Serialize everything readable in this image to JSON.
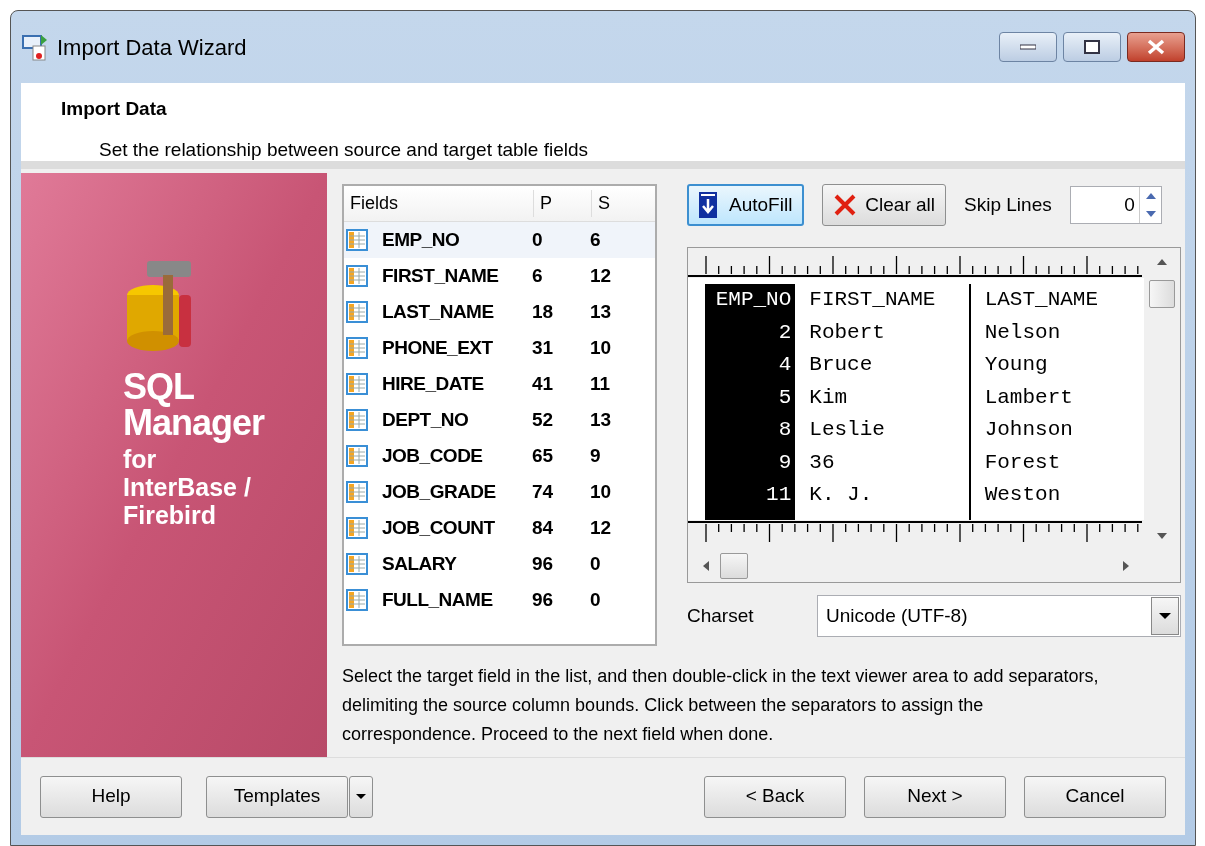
{
  "window": {
    "title": "Import Data Wizard"
  },
  "header": {
    "title": "Import Data",
    "subtitle": "Set the relationship between source and target table fields"
  },
  "banner": {
    "lines": [
      "SQL",
      "Manager"
    ],
    "sublines": [
      "for",
      "InterBase /",
      "Firebird"
    ]
  },
  "fields": {
    "columns": [
      "Fields",
      "P",
      "S"
    ],
    "rows": [
      {
        "name": "EMP_NO",
        "p": "0",
        "s": "6",
        "selected": true
      },
      {
        "name": "FIRST_NAME",
        "p": "6",
        "s": "12",
        "selected": false
      },
      {
        "name": "LAST_NAME",
        "p": "18",
        "s": "13",
        "selected": false
      },
      {
        "name": "PHONE_EXT",
        "p": "31",
        "s": "10",
        "selected": false
      },
      {
        "name": "HIRE_DATE",
        "p": "41",
        "s": "11",
        "selected": false
      },
      {
        "name": "DEPT_NO",
        "p": "52",
        "s": "13",
        "selected": false
      },
      {
        "name": "JOB_CODE",
        "p": "65",
        "s": "9",
        "selected": false
      },
      {
        "name": "JOB_GRADE",
        "p": "74",
        "s": "10",
        "selected": false
      },
      {
        "name": "JOB_COUNT",
        "p": "84",
        "s": "12",
        "selected": false
      },
      {
        "name": "SALARY",
        "p": "96",
        "s": "0",
        "selected": false
      },
      {
        "name": "FULL_NAME",
        "p": "96",
        "s": "0",
        "selected": false
      }
    ]
  },
  "toolbar": {
    "autofill": "AutoFill",
    "clear": "Clear all",
    "skip_label": "Skip Lines",
    "skip_value": "0"
  },
  "viewer": {
    "columns": [
      {
        "cells": [
          "EMP_NO",
          "2",
          "4",
          "5",
          "8",
          "9",
          "11"
        ],
        "selected": true
      },
      {
        "cells": [
          "FIRST_NAME",
          "Robert",
          "Bruce",
          "Kim",
          "Leslie",
          "36",
          "K. J."
        ],
        "selected": false
      },
      {
        "cells": [
          "LAST_NAME",
          "Nelson",
          "Young",
          "Lambert",
          "Johnson",
          "Forest",
          "Weston"
        ],
        "selected": false
      }
    ]
  },
  "charset": {
    "label": "Charset",
    "value": "Unicode (UTF-8)"
  },
  "hint": "Select the target field in the list, and then double-click in the text viewer area to add separators, delimiting the source column bounds. Click between the separators to assign the correspondence. Proceed to the next field when done.",
  "buttons": {
    "help": "Help",
    "templates": "Templates",
    "back": "< Back",
    "next": "Next >",
    "cancel": "Cancel"
  }
}
